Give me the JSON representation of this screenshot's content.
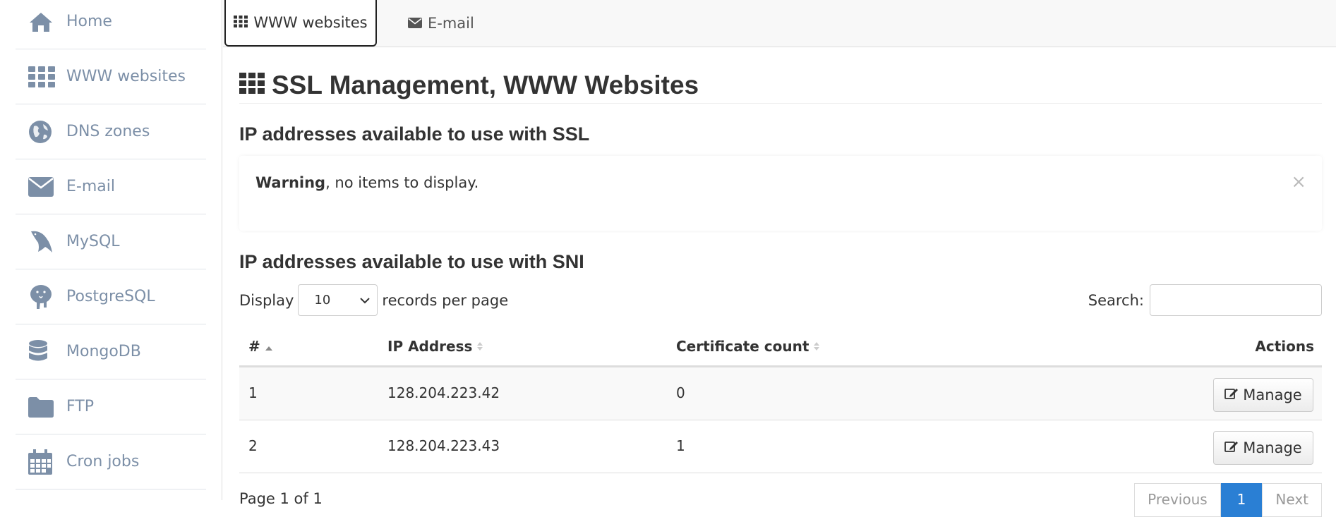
{
  "sidebar": {
    "items": [
      {
        "label": "Home",
        "icon": "home-icon"
      },
      {
        "label": "WWW websites",
        "icon": "grid-icon"
      },
      {
        "label": "DNS zones",
        "icon": "globe-icon"
      },
      {
        "label": "E-mail",
        "icon": "envelope-icon"
      },
      {
        "label": "MySQL",
        "icon": "dolphin-icon"
      },
      {
        "label": "PostgreSQL",
        "icon": "elephant-icon"
      },
      {
        "label": "MongoDB",
        "icon": "database-icon"
      },
      {
        "label": "FTP",
        "icon": "folder-icon"
      },
      {
        "label": "Cron jobs",
        "icon": "calendar-icon"
      }
    ]
  },
  "tabs": {
    "www": "WWW websites",
    "email": "E-mail"
  },
  "page": {
    "title": "SSL Management, WWW Websites",
    "ssl_heading": "IP addresses available to use with SSL",
    "alert_strong": "Warning",
    "alert_text": ", no items to display.",
    "alert_close": "×",
    "sni_heading": "IP addresses available to use with SNI"
  },
  "table_controls": {
    "display_label": "Display",
    "page_size": "10",
    "records_label": "records per page",
    "search_label": "Search:",
    "search_value": ""
  },
  "table": {
    "columns": [
      "#",
      "IP Address",
      "Certificate count",
      "Actions"
    ],
    "rows": [
      {
        "num": "1",
        "ip": "128.204.223.42",
        "count": "0",
        "action": "Manage"
      },
      {
        "num": "2",
        "ip": "128.204.223.43",
        "count": "1",
        "action": "Manage"
      }
    ]
  },
  "footer": {
    "page_info": "Page 1 of 1",
    "previous": "Previous",
    "current": "1",
    "next": "Next"
  },
  "colors": {
    "sidebar_text": "#7c8fa7",
    "accent": "#2a7fd4"
  }
}
